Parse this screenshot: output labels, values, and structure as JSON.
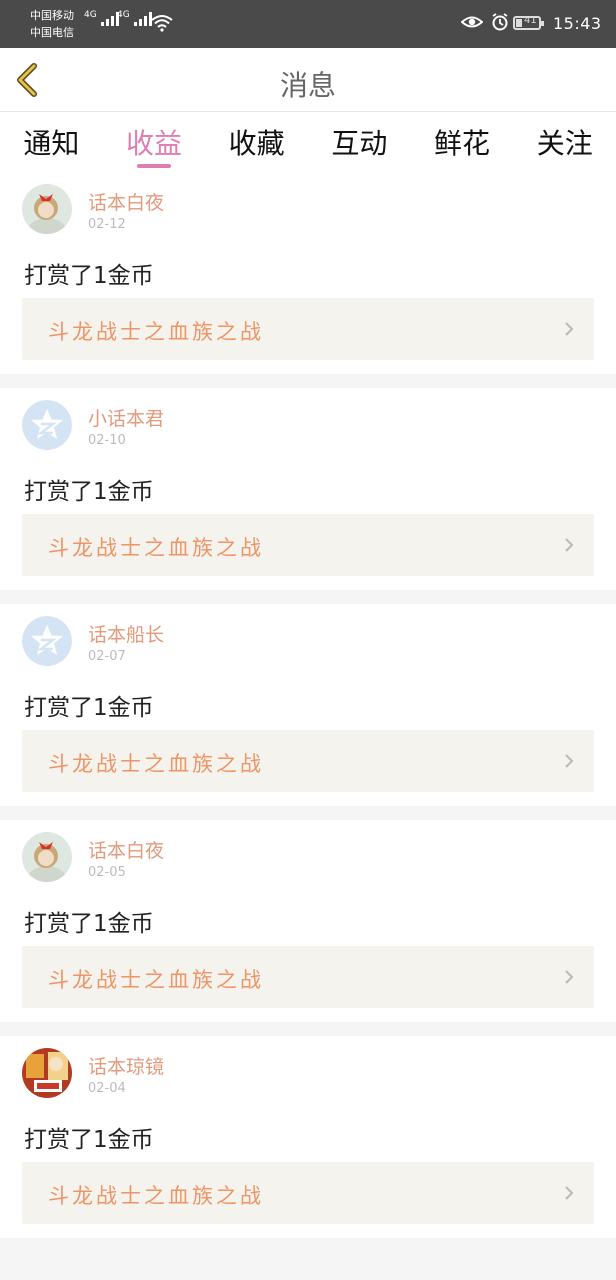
{
  "status_bar": {
    "carrier1": "中国移动",
    "carrier2": "中国电信",
    "network1": "4G",
    "network2": "4G",
    "battery": "41",
    "time": "15:43"
  },
  "header": {
    "title": "消息"
  },
  "tabs": [
    {
      "label": "通知",
      "active": false
    },
    {
      "label": "收益",
      "active": true
    },
    {
      "label": "收藏",
      "active": false
    },
    {
      "label": "互动",
      "active": false
    },
    {
      "label": "鲜花",
      "active": false
    },
    {
      "label": "关注",
      "active": false
    }
  ],
  "messages": [
    {
      "user": "话本白夜",
      "date": "02-12",
      "text": "打赏了1金币",
      "book": "斗龙战士之血族之战"
    },
    {
      "user": "小话本君",
      "date": "02-10",
      "text": "打赏了1金币",
      "book": "斗龙战士之血族之战"
    },
    {
      "user": "话本船长",
      "date": "02-07",
      "text": "打赏了1金币",
      "book": "斗龙战士之血族之战"
    },
    {
      "user": "话本白夜",
      "date": "02-05",
      "text": "打赏了1金币",
      "book": "斗龙战士之血族之战"
    },
    {
      "user": "话本琼镜",
      "date": "02-04",
      "text": "打赏了1金币",
      "book": "斗龙战士之血族之战"
    }
  ],
  "colors": {
    "accent_tab": "#e07eb0",
    "username": "#e39a7c",
    "book_title": "#ee9566",
    "back_arrow": "#e7c24a"
  }
}
